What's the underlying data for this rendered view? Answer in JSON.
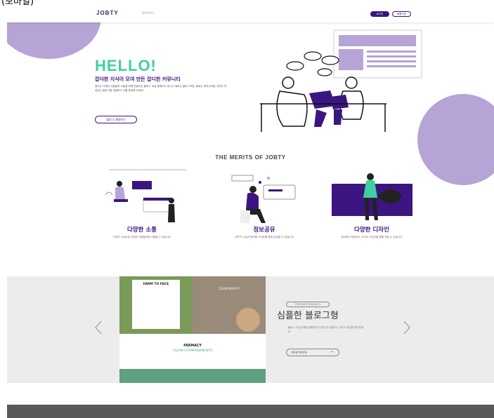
{
  "top_fragment": "(모바일)",
  "header": {
    "logo": "JOBTY",
    "nav_item": "MENU01",
    "login_label": "로그인",
    "join_label": "회원가입"
  },
  "hero": {
    "title": "HELLO!",
    "subtitle": "잡다한 지식이 모여 만든 잡디한 커뮤니티",
    "description": "잡티는 다양한 사람들과 소통을 위해 만들어진 블로그 개설 홈페이지 입니다 때로는 블로그처럼, 때로는 매거진처럼 나만의 개성있는 블로그를 개설하고 나를 표현해 보세요!",
    "button_label": "블로그 개설하기"
  },
  "merits": {
    "title": "THE MERITS OF JOBTY",
    "items": [
      {
        "title": "다양한 소통",
        "desc": "나만의 사이트로 다양한 사람들이랑 소통할 수 있습니다"
      },
      {
        "title": "정보공유",
        "desc": "나만의 스킬과 정보를 사이트를 통해 공유할 수 있습니다"
      },
      {
        "title": "다양한 디자인",
        "desc": "잡티에서 제공하는 사이트 디자인을 통해 꾸밀 수 있습니다"
      }
    ]
  },
  "slider": {
    "card": {
      "farm": "FARM\nTO\nFACE",
      "clean": "CLEAN\nBEAUTY",
      "farmacy": "FARMACY",
      "commandments": "- CLEAN COMMANDMENTS -"
    },
    "tag": "TEMPLATE DESIGN 01",
    "title": "심플한 블로그형",
    "description": "블로그 초심자에게 맞춤형인 디자인 미니멀하고 나만의 개성을 부여하세요",
    "button_label": "VIEW MORE",
    "prev_icon": "chevron-left-icon",
    "next_icon": "chevron-right-icon"
  },
  "colors": {
    "brand": "#3b1580",
    "accent": "#3fcf9f",
    "lavender": "#b6a4d6",
    "footer": "#595959"
  }
}
